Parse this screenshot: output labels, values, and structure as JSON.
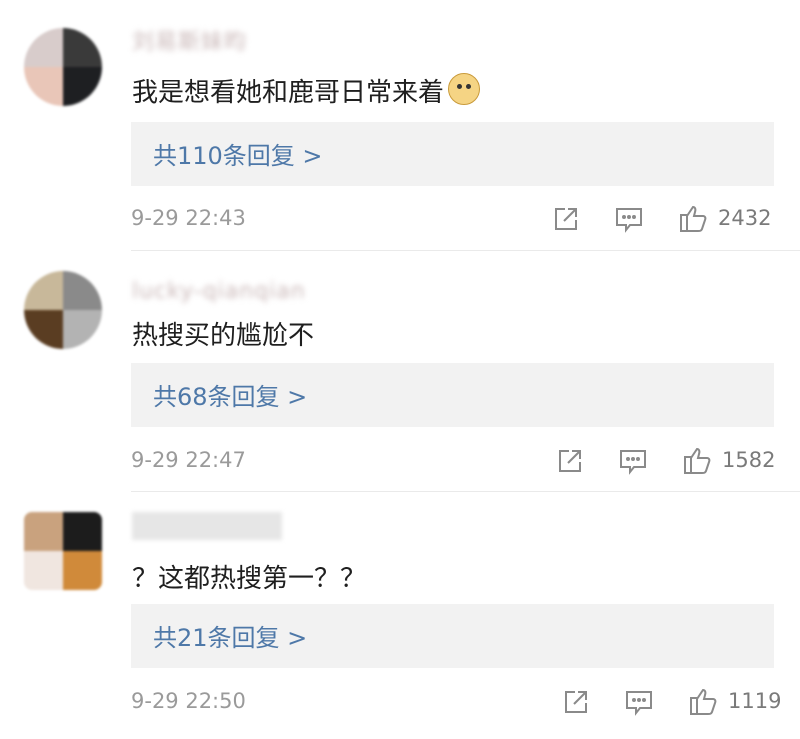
{
  "comments": [
    {
      "username": "刘易斯妹昀",
      "text": "我是想看她和鹿哥日常来着",
      "emoji": "doge-emoji",
      "replies_label": "共110条回复 >",
      "time": "9-29 22:43",
      "likes": "2432",
      "avatar_colors": [
        "#d8cccb",
        "#3a3a3a",
        "#e9c6b8",
        "#1e1f22"
      ]
    },
    {
      "username": "lucky-qianqian",
      "text": "热搜买的尴尬不",
      "replies_label": "共68条回复 >",
      "time": "9-29 22:47",
      "likes": "1582",
      "avatar_colors": [
        "#c8b89a",
        "#8a8a8a",
        "#5a3d22",
        "#b3b3b3"
      ]
    },
    {
      "username": "",
      "text": "？这都热搜第一？？",
      "replies_label": "共21条回复 >",
      "time": "9-29 22:50",
      "likes": "1119",
      "avatar_colors": [
        "#c9a27e",
        "#1c1c1c",
        "#f0e6e0",
        "#d08a3a"
      ]
    }
  ],
  "icons": {
    "share": "share-icon",
    "comment": "comment-icon",
    "like": "thumbs-up-icon"
  },
  "colors": {
    "link": "#4e78a8",
    "reply_bg": "#f2f2f2",
    "muted": "#9a9a9a"
  }
}
